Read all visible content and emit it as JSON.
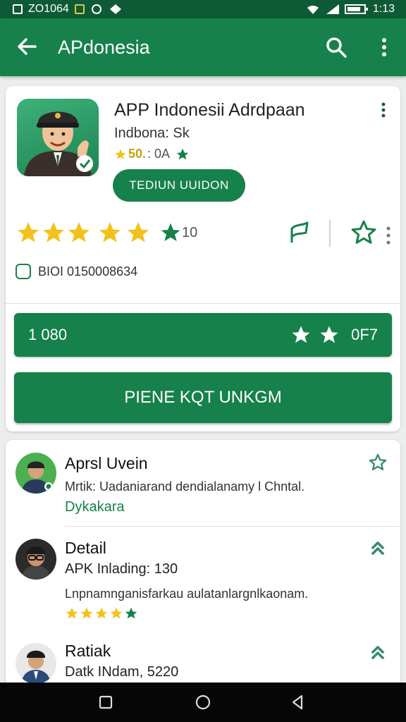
{
  "status_bar": {
    "time_left": "ZO1064",
    "time_right": "1:13"
  },
  "app_bar": {
    "title": "APdonesia"
  },
  "app_card": {
    "title": "APP Indonesii Adrdpaan",
    "developer": "Indbona: Sk",
    "rating_score": "50.",
    "rating_extra": ": 0A",
    "install_button": "TEDIUN UUIDON",
    "rating_number": "10",
    "info_text": "BIOI 0150008634",
    "bar_label": "1 080",
    "bar_right": "0F7",
    "primary_button": "PIENE KQT UNKGM",
    "accent": "#16814a",
    "star_color": "#f2c21b"
  },
  "list": [
    {
      "title": "Aprsl Uvein",
      "description": "Mrtik: Uadaniarand dendialanamy l Chntal.",
      "subtitle": "Dykakara",
      "icon": "star-outline-icon"
    },
    {
      "title": "Detail",
      "line": "APK Inlading: 130",
      "description": "Lnpnamnganisfarkau aulatanlargnlkaonam.",
      "icon": "chevrons-up-icon"
    },
    {
      "title": "Ratiak",
      "line": "Datk INdam, 5220",
      "icon": "chevrons-up-icon"
    }
  ]
}
